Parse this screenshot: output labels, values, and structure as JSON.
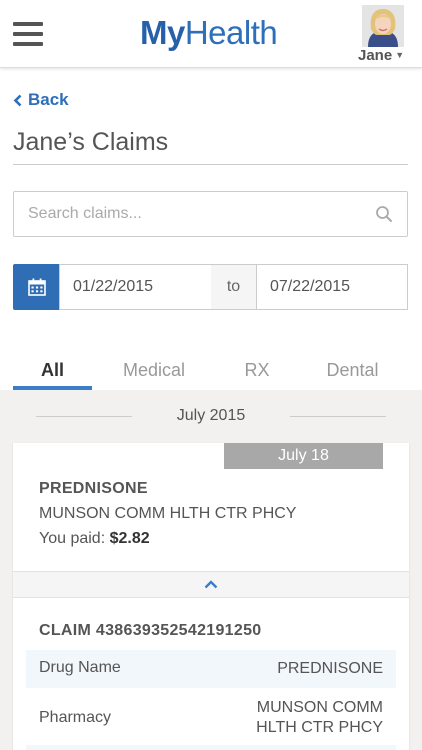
{
  "header": {
    "logo_my": "My",
    "logo_health": "Health",
    "user_name": "Jane"
  },
  "nav": {
    "back_label": "Back"
  },
  "page": {
    "title": "Jane’s Claims"
  },
  "search": {
    "placeholder": "Search claims..."
  },
  "date_range": {
    "from": "01/22/2015",
    "to_label": "to",
    "to": "07/22/2015"
  },
  "tabs": [
    {
      "label": "All",
      "active": true
    },
    {
      "label": "Medical",
      "active": false
    },
    {
      "label": "RX",
      "active": false
    },
    {
      "label": "Dental",
      "active": false
    }
  ],
  "month_group": {
    "label": "July 2015"
  },
  "claim": {
    "date": "July 18",
    "drug": "PREDNISONE",
    "pharmacy": "MUNSON COMM HLTH CTR PHCY",
    "paid_label": "You paid:",
    "paid_amount": "$2.82",
    "claim_label": "CLAIM 438639352542191250",
    "details": [
      {
        "key": "Drug Name",
        "value": "PREDNISONE"
      },
      {
        "key": "Pharmacy",
        "value_line1": "MUNSON COMM",
        "value_line2": "HLTH CTR PHCY"
      }
    ]
  },
  "colors": {
    "brand_blue": "#2d6fb8",
    "calendar_button": "#2f6db5",
    "tab_indicator": "#3d7dc8",
    "date_badge": "#a8a8a8",
    "list_background": "#f2f1ef"
  }
}
